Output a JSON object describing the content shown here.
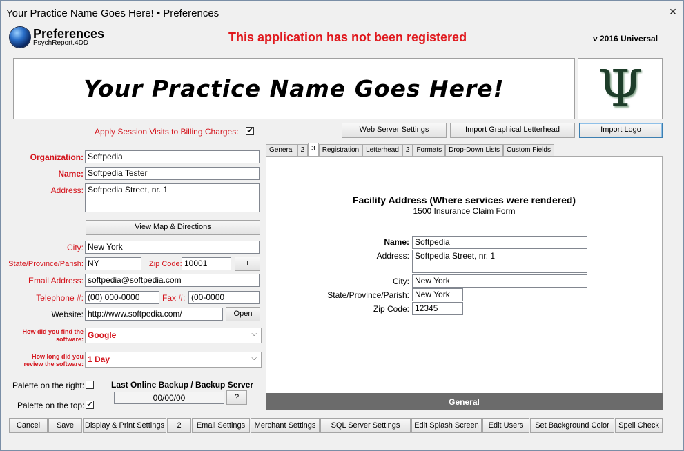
{
  "window": {
    "title": "Your Practice Name Goes Here!  • Preferences",
    "close_label": "✕"
  },
  "header": {
    "title": "Preferences",
    "subtitle": "PsychReport.4DD",
    "warning": "This application has not been registered",
    "version": "v 2016 Universal"
  },
  "banner": {
    "text": "Your Practice Name Goes Here!",
    "logo_glyph": "Ψ"
  },
  "billing": {
    "label": "Apply Session Visits to Billing Charges:",
    "checked": "✔"
  },
  "buttons": {
    "web_server": "Web Server Settings",
    "import_letterhead": "Import Graphical Letterhead",
    "import_logo": "Import Logo",
    "view_map": "View Map & Directions",
    "zip_plus": "+",
    "open": "Open",
    "backup_help": "?"
  },
  "form": {
    "organization": {
      "label": "Organization:",
      "value": "Softpedia"
    },
    "name": {
      "label": "Name:",
      "value": "Softpedia Tester"
    },
    "address": {
      "label": "Address:",
      "value": "Softpedia Street, nr. 1"
    },
    "city": {
      "label": "City:",
      "value": "New York"
    },
    "state": {
      "label": "State/Province/Parish:",
      "value": "NY"
    },
    "zip": {
      "label": "Zip Code:",
      "value": "10001"
    },
    "email": {
      "label": "Email Address:",
      "value": "softpedia@softpedia.com"
    },
    "telephone": {
      "label": "Telephone #:",
      "value": "(00) 000-0000"
    },
    "fax": {
      "label": "Fax #:",
      "value": "(00-0000"
    },
    "website": {
      "label": "Website:",
      "value": "http://www.softpedia.com/"
    },
    "find_software": {
      "label_line1": "How did you find the",
      "label_line2": "software:",
      "value": "Google"
    },
    "review_time": {
      "label_line1": "How long did you",
      "label_line2": "review the software:",
      "value": "1 Day"
    }
  },
  "palette": {
    "right_label": "Palette on the right:",
    "right_checked": "",
    "top_label": "Palette on the top:",
    "top_checked": "✔"
  },
  "backup": {
    "title": "Last Online Backup / Backup Server",
    "value": "00/00/00"
  },
  "tabs": [
    {
      "label": "General"
    },
    {
      "label": "2"
    },
    {
      "label": "3"
    },
    {
      "label": "Registration"
    },
    {
      "label": "Letterhead"
    },
    {
      "label": "2"
    },
    {
      "label": "Formats"
    },
    {
      "label": "Drop-Down Lists"
    },
    {
      "label": "Custom Fields"
    }
  ],
  "facility": {
    "title": "Facility Address (Where services were rendered)",
    "subtitle": "1500 Insurance Claim Form",
    "name_label": "Name:",
    "name_value": "Softpedia",
    "address_label": "Address:",
    "address_value": "Softpedia Street, nr. 1",
    "city_label": "City:",
    "city_value": "New York",
    "state_label": "State/Province/Parish:",
    "state_value": "New York",
    "zip_label": "Zip Code:",
    "zip_value": "12345",
    "footer": "General"
  },
  "bottom_bar": [
    "Cancel",
    "Save",
    "Display & Print Settings",
    "2",
    "Email Settings",
    "Merchant Settings",
    "SQL Server Settings",
    "Edit Splash Screen",
    "Edit Users",
    "Set Background Color",
    "Spell Check"
  ]
}
